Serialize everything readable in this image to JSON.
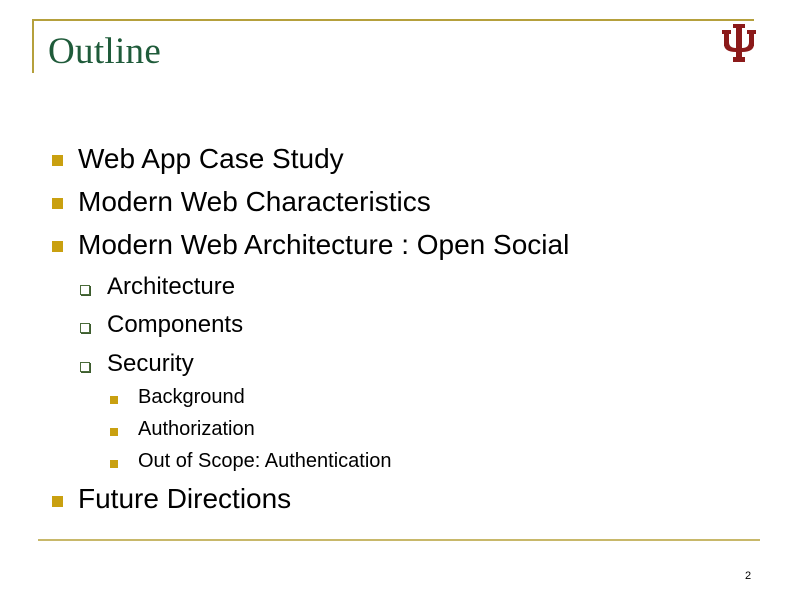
{
  "slide": {
    "title": "Outline",
    "logo": "indiana-university-trident-logo",
    "page_number": "2",
    "colors": {
      "title": "#1f5b3a",
      "rule": "#b5a03c",
      "bullet": "#c9a010",
      "sub_bullet_border": "#4a6b3a",
      "logo": "#8b1a1a"
    },
    "bullets": [
      {
        "text": "Web App Case Study"
      },
      {
        "text": "Modern Web Characteristics"
      },
      {
        "text": "Modern Web Architecture : Open Social",
        "children": [
          {
            "text": "Architecture"
          },
          {
            "text": "Components"
          },
          {
            "text": "Security",
            "children": [
              {
                "text": "Background"
              },
              {
                "text": "Authorization"
              },
              {
                "text": "Out of Scope: Authentication"
              }
            ]
          }
        ]
      },
      {
        "text": "Future Directions"
      }
    ]
  }
}
